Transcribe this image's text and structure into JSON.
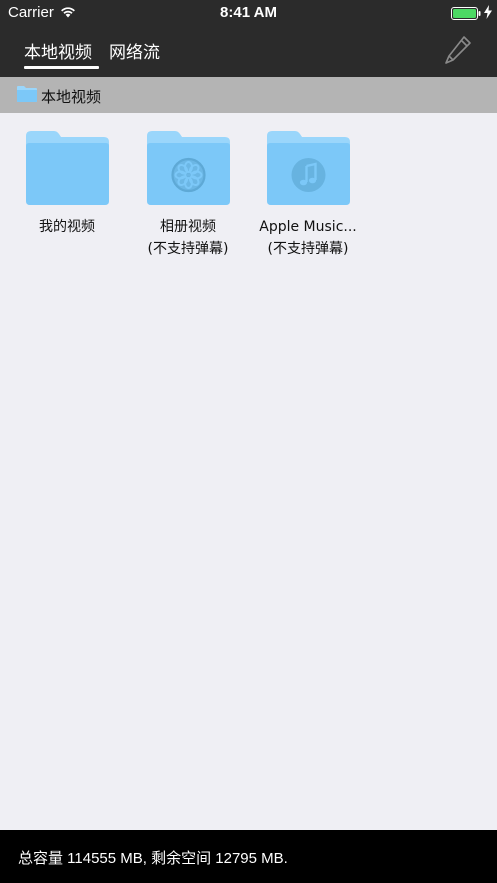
{
  "status_bar": {
    "carrier": "Carrier",
    "time": "8:41 AM",
    "battery_color": "#4cd964"
  },
  "header": {
    "tabs": [
      {
        "label": "本地视频",
        "selected": true
      },
      {
        "label": "网络流",
        "selected": false
      }
    ],
    "edit_icon": "pencil-icon"
  },
  "breadcrumb": {
    "icon": "folder-icon",
    "label": "本地视频"
  },
  "folders": [
    {
      "name": "我的视频",
      "note": "",
      "icon": "folder-icon"
    },
    {
      "name": "相册视频",
      "note": "(不支持弹幕)",
      "icon": "photos-folder-icon"
    },
    {
      "name": "Apple Music...",
      "note": "(不支持弹幕)",
      "icon": "music-folder-icon"
    }
  ],
  "footer": {
    "storage_text": "总容量 114555 MB, 剩余空间 12795 MB."
  },
  "colors": {
    "header_bg": "#2b2b2b",
    "folder_blue": "#7cc8f8",
    "folder_tab": "#9ad6fb",
    "page_bg": "#efeff4"
  }
}
